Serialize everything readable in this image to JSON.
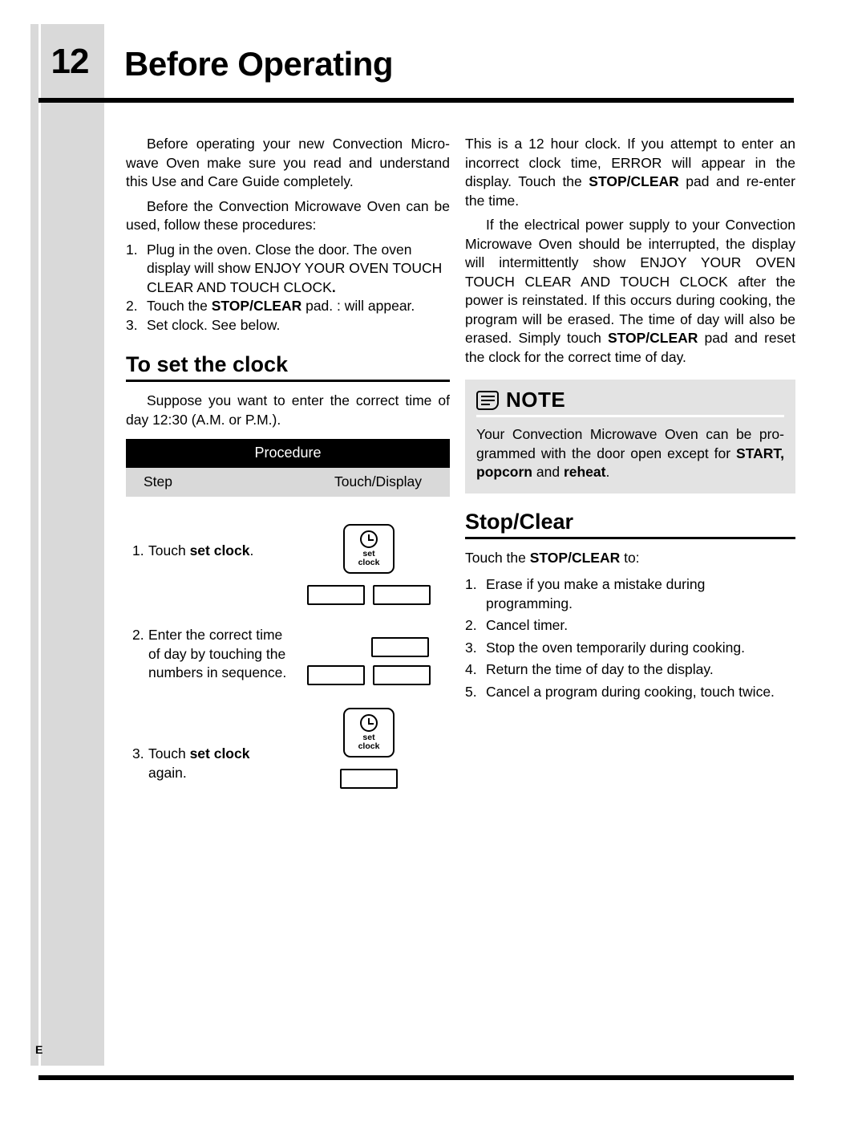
{
  "page": {
    "number": "12",
    "title": "Before Operating",
    "edition_mark": "E"
  },
  "left_column": {
    "intro_p1": "Before operating your new Convection Micro-wave Oven make sure you read and understand this Use and Care Guide completely.",
    "intro_p2": "Before the Convection Microwave Oven can be used, follow these procedures:",
    "steps": [
      {
        "num": "1.",
        "text_pre": "Plug in the oven. Close the door. The oven display will show ENJOY YOUR OVEN TOUCH CLEAR AND TOUCH CLOCK",
        "text_post": "."
      },
      {
        "num": "2.",
        "text_pre": "Touch the ",
        "bold": "STOP/CLEAR",
        "text_post": " pad.  :  will appear."
      },
      {
        "num": "3.",
        "text_pre": "Set clock. See below.",
        "text_post": ""
      }
    ],
    "clock_section": {
      "heading": "To set the clock",
      "paragraph": "Suppose you want to enter the correct time of day 12:30 (A.M. or P.M.)."
    },
    "procedure_table": {
      "title": "Procedure",
      "col_step": "Step",
      "col_touch": "Touch/Display",
      "rows": [
        {
          "num": "1.",
          "text_pre": "Touch ",
          "bold": "set clock",
          "text_post": ".",
          "pad_label_line1": "set",
          "pad_label_line2": "clock"
        },
        {
          "num": "2.",
          "text_pre": "Enter the correct time of day by touching the numbers in sequence.",
          "bold": "",
          "text_post": ""
        },
        {
          "num": "3.",
          "text_pre": "Touch ",
          "bold": "set clock",
          "text_post": " again.",
          "pad_label_line1": "set",
          "pad_label_line2": "clock"
        }
      ]
    }
  },
  "right_column": {
    "p1_a": "This is a 12 hour clock. If you attempt to enter an incorrect clock time, ERROR will appear in the display. Touch the ",
    "p1_bold": "STOP/CLEAR",
    "p1_b": " pad and re-enter the time.",
    "p2_a": "If the electrical power supply to your Convection Microwave Oven should be interrupted, the display will intermittently show ENJOY YOUR OVEN TOUCH CLEAR AND TOUCH CLOCK after the power is reinstated. If this occurs during cooking, the program will be erased. The time of day will also be erased. Simply touch ",
    "p2_bold": "STOP/CLEAR",
    "p2_b": " pad and reset the clock for the correct time of day.",
    "note": {
      "title": "NOTE",
      "body_a": "Your Convection Microwave Oven can be pro-grammed with the door open except for ",
      "body_bold1": "START,",
      "body_bold2": "popcorn",
      "body_mid": " and ",
      "body_bold3": "reheat",
      "body_end": "."
    },
    "stop_clear": {
      "heading": "Stop/Clear",
      "lead_a": "Touch the ",
      "lead_bold": "STOP/CLEAR",
      "lead_b": " to:",
      "items": [
        {
          "num": "1.",
          "text": "Erase if you make a mistake during programming."
        },
        {
          "num": "2.",
          "text": "Cancel timer."
        },
        {
          "num": "3.",
          "text": "Stop the oven temporarily during cooking."
        },
        {
          "num": "4.",
          "text": "Return the time of day to the display."
        },
        {
          "num": "5.",
          "text": "Cancel a program during cooking, touch twice."
        }
      ]
    }
  }
}
